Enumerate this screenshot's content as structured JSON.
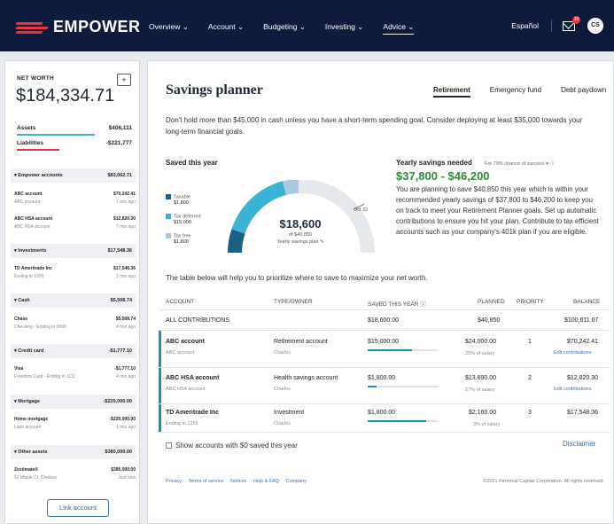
{
  "brand": {
    "name": "EMPOWER",
    "accent": "#e8343b",
    "navy": "#0f1b3d"
  },
  "nav": [
    "Overview ⌄",
    "Account ⌄",
    "Budgeting ⌄",
    "Investing ⌄",
    "Advice ⌄"
  ],
  "topright": {
    "language": "Español",
    "mail_badge": "10",
    "avatar": "CS"
  },
  "sidebar": {
    "net_worth_label": "NET WORTH",
    "plus": "+",
    "net_worth": "$184,334.71",
    "assets_label": "Assets",
    "assets": "$406,111",
    "liabilities_label": "Liabilities",
    "liabilities": "-$221,777",
    "groups": [
      {
        "label": "▾ Empower accounts",
        "total": "$83,062.71"
      },
      {
        "label": "▾ Investments",
        "total": "$17,548.36"
      },
      {
        "label": "▾ Cash",
        "total": "$5,508.74"
      },
      {
        "label": "▾ Credit card",
        "total": "-$1,777.10"
      },
      {
        "label": "▾ Mortgage",
        "total": "-$220,000.00"
      },
      {
        "label": "▾ Other assets",
        "total": "$380,000.00"
      }
    ],
    "accounts": [
      {
        "name": "ABC account",
        "amount": "$70,242.41",
        "sub": "ABC account",
        "time": "7 min ago"
      },
      {
        "name": "ABC HSA account",
        "amount": "$12,820.30",
        "sub": "ABC HSA account",
        "time": "7 min ago"
      },
      {
        "name": "TD Ameritrade Inc",
        "amount": "$17,548.36",
        "sub": "Ending in 1255",
        "time": "2 min ago"
      },
      {
        "name": "Chase",
        "amount": "$5,508.74",
        "sub": "Checking - Ending in 9999",
        "time": "4 min ago"
      },
      {
        "name": "Visa",
        "amount": "-$1,777.10",
        "sub": "Freedom Card - Ending in 1111",
        "time": "4 min ago"
      },
      {
        "name": "Home mortgage",
        "amount": "-$220,000.00",
        "sub": "Loan account",
        "time": "1 min ago"
      },
      {
        "name": "Zestimate®",
        "amount": "$380,000.00",
        "sub": "52 Maple Ct. Chelsea",
        "time": "Just now"
      }
    ],
    "link_account": "Link account"
  },
  "main": {
    "title": "Savings planner",
    "tabs": [
      "Retirement",
      "Emergency fund",
      "Debt paydown"
    ],
    "intro": "Don't hold more than $45,000 in cash unless you have a short-term spending goal. Consider deploying at least $35,000 towards your long-term financial goals.",
    "saved_title": "Saved this year",
    "legend": [
      {
        "label": "Taxable",
        "value": "$1,800",
        "color": "#1b5f85"
      },
      {
        "label": "Tax deferred",
        "value": "$15,000",
        "color": "#3bb3d6"
      },
      {
        "label": "Tax free",
        "value": "$1,800",
        "color": "#a8c8e4"
      }
    ],
    "gauge": {
      "amount": "$18,600",
      "of": "of $40,850",
      "plan": "Yearly savings plan ✎",
      "date": "Oct 22",
      "fraction": 0.455
    },
    "ysn_title": "Yearly savings needed",
    "ysn_sub": "For 70% chance of success ▾ ⓘ",
    "ysn_range": "$37,800 - $46,200",
    "ysn_body": "You are planning to save $40,850 this year which is within your recommended yearly savings of $37,800 to $46,200 to keep you on track to meet your Retirement Planner goals. Set up automatic contributions to ensure you hit your plan. Contribute to tax efficient accounts such as your company's 401k plan if you are eligible.",
    "table_intro": "The table below will help you to prioritize where to save to maximize your net worth.",
    "headers": {
      "account": "ACCOUNT",
      "type": "TYPE/OWNER",
      "saved": "SAVED THIS YEAR ⓘ",
      "planned": "PLANNED",
      "priority": "PRIORITY",
      "balance": "BALANCE"
    },
    "all": {
      "label": "ALL CONTRIBUTIONS",
      "saved": "$18,600.00",
      "planned": "$40,850",
      "balance": "$100,611.07"
    },
    "rows": [
      {
        "name": "ABC account",
        "sub": "ABC account",
        "type": "Retirement account",
        "owner": "Charles",
        "saved": "$15,000.00",
        "planned": "$24,000.00",
        "pct": "25% of salary",
        "priority": "1",
        "balance": "$70,242.41",
        "edit": "Edit contributions",
        "progress": 0.625
      },
      {
        "name": "ABC HSA account",
        "sub": "ABC HSA account",
        "type": "Health savings account",
        "owner": "Charles",
        "saved": "$1,800.00",
        "planned": "$13,690.00",
        "pct": "17% of salary",
        "priority": "2",
        "balance": "$12,820.30",
        "edit": "Edit contributions",
        "progress": 0.13
      },
      {
        "name": "TD Ameritrade Inc",
        "sub": "Ending in 1255",
        "type": "Investment",
        "owner": "Charles",
        "saved": "$1,800.00",
        "planned": "$2,160.00",
        "pct": "3% of salary",
        "priority": "3",
        "balance": "$17,548.36",
        "edit": "",
        "progress": 0.83
      }
    ],
    "show_zero": "Show accounts with $0 saved this year",
    "disclaimer": "Disclaimer",
    "footer_links": [
      "Privacy",
      "Terms of service",
      "Notices",
      "Help & FAQ",
      "Company"
    ],
    "copyright": "©2021 Personal Capital Corporation. All rights reserved."
  }
}
